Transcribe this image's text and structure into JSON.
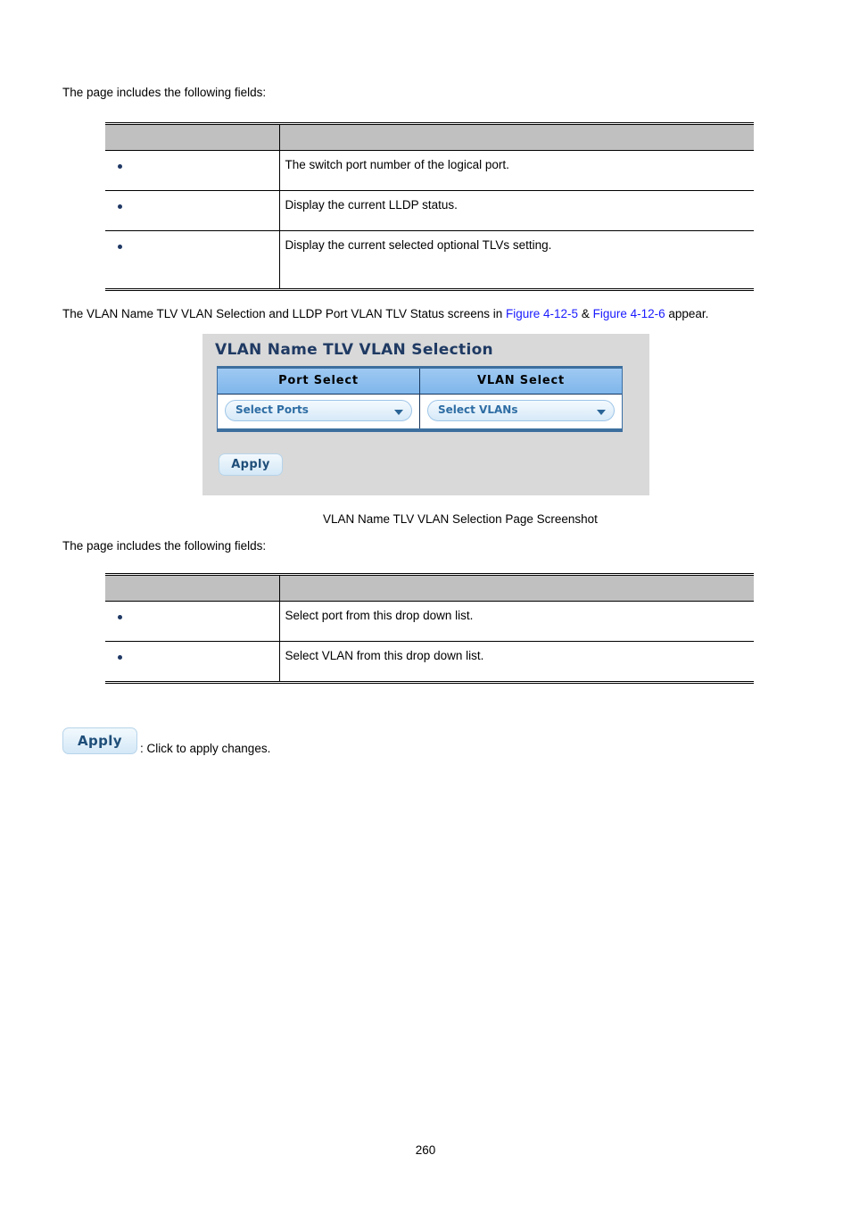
{
  "intro_paragraph_1": "The page includes the following fields:",
  "table_1": {
    "headers": [
      "",
      ""
    ],
    "rows": [
      {
        "object": "",
        "description": "The switch port number of the logical port."
      },
      {
        "object": "",
        "description": "Display the current LLDP status."
      },
      {
        "object": "",
        "description": "Display the current selected optional TLVs setting."
      }
    ]
  },
  "figure_intro": {
    "text_before": "The VLAN Name TLV VLAN Selection and LLDP Port VLAN TLV Status screens in ",
    "link_1": "Figure 4-12-5",
    "text_between": " & ",
    "link_2": "Figure 4-12-6",
    "text_after": " appear.",
    "link_color": "#1a1aff"
  },
  "figure": {
    "title": "VLAN Name TLV VLAN Selection",
    "table": {
      "headers": [
        "Port Select",
        "VLAN Select"
      ],
      "controls": [
        {
          "name": "port-select-dropdown",
          "value": "Select Ports"
        },
        {
          "name": "vlan-select-dropdown",
          "value": "Select VLANs"
        }
      ]
    },
    "apply_label": "Apply",
    "background_color": "#d9d9d9",
    "header_color": "#8ec1f0",
    "title_color": "#1f3a63"
  },
  "figure_caption": "VLAN Name TLV VLAN Selection Page Screenshot",
  "intro_paragraph_2": "The page includes the following fields:",
  "table_2": {
    "headers": [
      "",
      ""
    ],
    "rows": [
      {
        "object": "",
        "description": "Select port from this drop down list."
      },
      {
        "object": "",
        "description": "Select VLAN from this drop down list."
      }
    ]
  },
  "apply_note": {
    "button_label": "Apply",
    "description": ": Click to apply changes."
  },
  "page_number": "260"
}
